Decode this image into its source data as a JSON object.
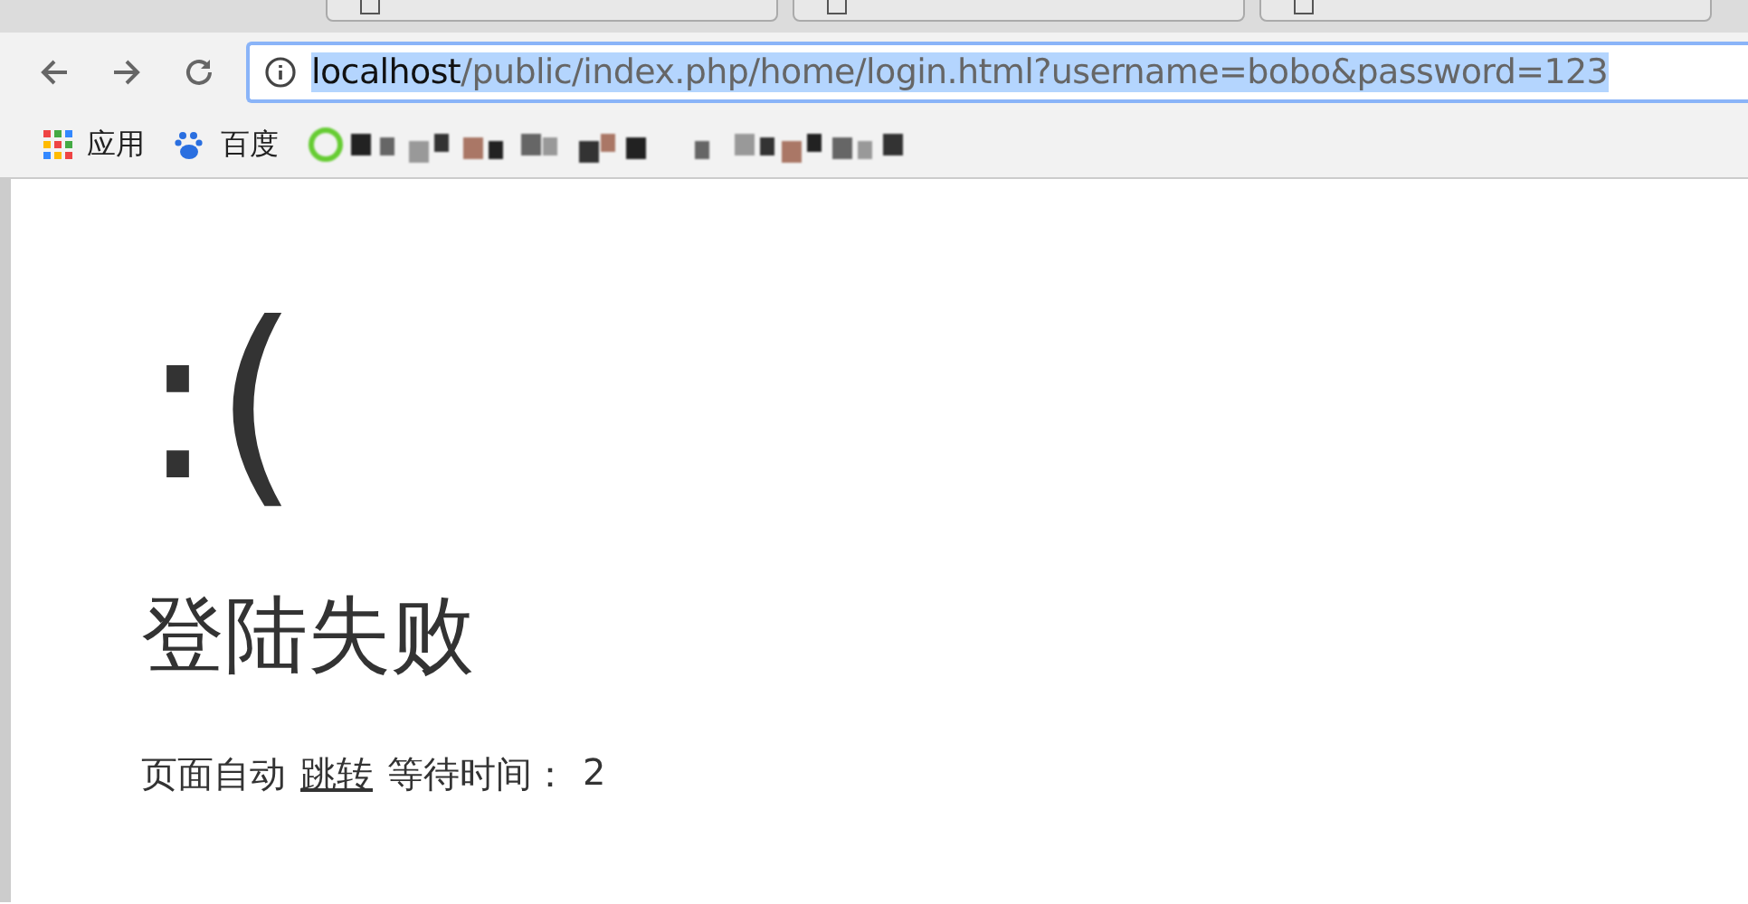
{
  "address_bar": {
    "host": "localhost",
    "path": "/public/index.php/home/login.html?username=bobo&password=123",
    "selected": true
  },
  "bookmarks": [
    {
      "kind": "apps",
      "label": "应用"
    },
    {
      "kind": "paw",
      "label": "百度"
    }
  ],
  "page": {
    "face": ":(",
    "heading": "登陆失败",
    "message": "页面自动",
    "link": "跳转",
    "wait_label": "等待时间：",
    "wait_value": "2"
  }
}
